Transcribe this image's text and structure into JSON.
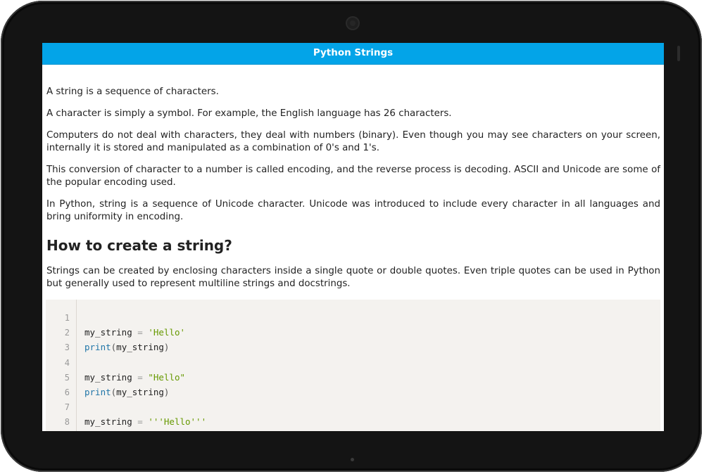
{
  "app_bar": {
    "title": "Python Strings"
  },
  "article": {
    "paragraphs": [
      "A string is a sequence of characters.",
      "A character is simply a symbol. For example, the English language has 26 characters.",
      "Computers do not deal with characters, they deal with numbers (binary). Even though you may see characters on your screen, internally it is stored and manipulated as a combination of 0's and 1's.",
      "This conversion of character to a number is called encoding, and the reverse process is decoding. ASCII and Unicode are some of the popular encoding used.",
      "In Python, string is a sequence of Unicode character. Unicode was introduced to include every character in all languages and bring uniformity in encoding."
    ],
    "section_heading": "How to create a string?",
    "section_paragraph": "Strings can be created by enclosing characters inside a single quote or double quotes. Even triple quotes can be used in Python but generally used to represent multiline strings and docstrings."
  },
  "code": {
    "line_numbers": [
      "1",
      "2",
      "3",
      "4",
      "5",
      "6",
      "7",
      "8"
    ],
    "lines": [
      {
        "var": "",
        "op": "",
        "str": "",
        "fn": "",
        "open": "",
        "arg": "",
        "close": ""
      },
      {
        "var": "my_string ",
        "op": "=",
        "str": " 'Hello'",
        "fn": "",
        "open": "",
        "arg": "",
        "close": ""
      },
      {
        "var": "",
        "op": "",
        "str": "",
        "fn": "print",
        "open": "(",
        "arg": "my_string",
        "close": ")"
      },
      {
        "var": "",
        "op": "",
        "str": "",
        "fn": "",
        "open": "",
        "arg": "",
        "close": ""
      },
      {
        "var": "my_string ",
        "op": "=",
        "str": " \"Hello\"",
        "fn": "",
        "open": "",
        "arg": "",
        "close": ""
      },
      {
        "var": "",
        "op": "",
        "str": "",
        "fn": "print",
        "open": "(",
        "arg": "my_string",
        "close": ")"
      },
      {
        "var": "",
        "op": "",
        "str": "",
        "fn": "",
        "open": "",
        "arg": "",
        "close": ""
      },
      {
        "var": "my_string ",
        "op": "=",
        "str": " '''Hello'''",
        "fn": "",
        "open": "",
        "arg": "",
        "close": ""
      }
    ]
  },
  "colors": {
    "app_bar": "#03a4e8",
    "code_background": "#f4f2ef",
    "string_token": "#669900",
    "function_token": "#1f75a8"
  },
  "device": {
    "icons": [
      "front-camera-icon",
      "side-button-icon",
      "home-indicator-icon"
    ]
  }
}
